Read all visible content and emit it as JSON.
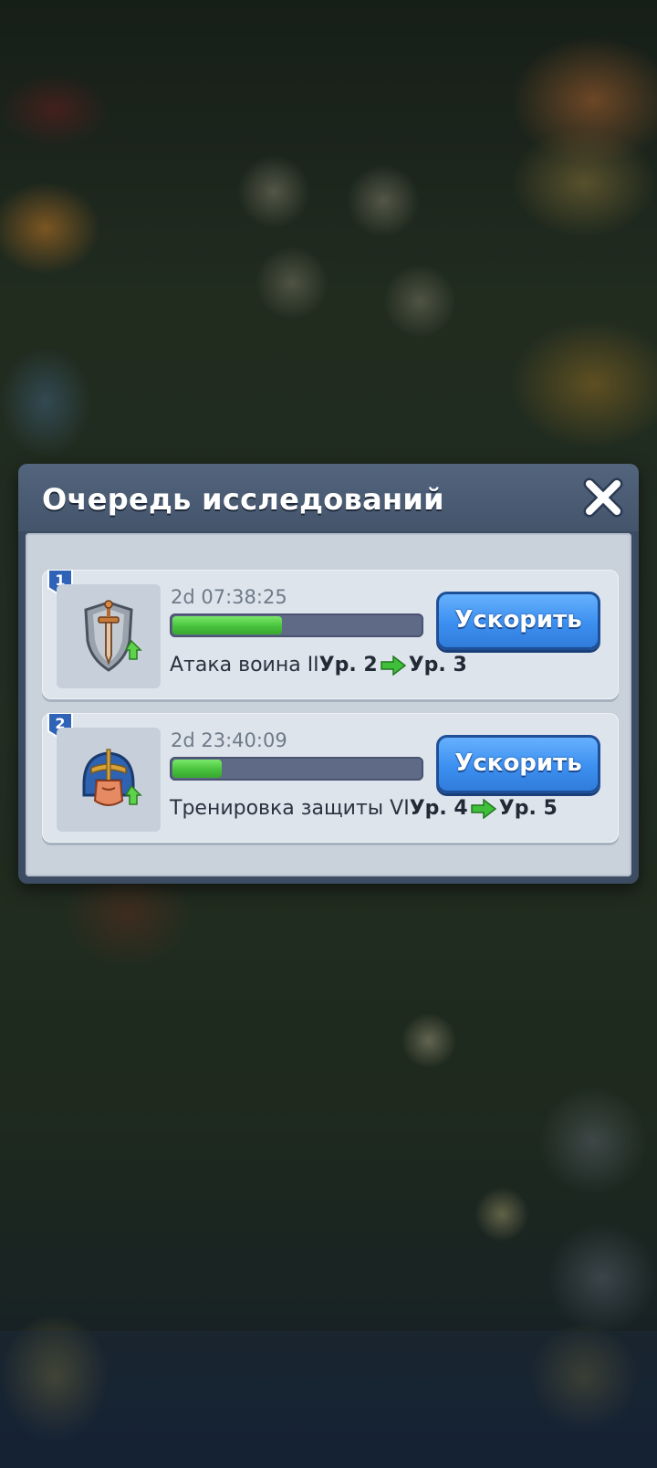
{
  "dialog": {
    "title": "Очередь исследований",
    "close_icon": "close-x-icon"
  },
  "queue": [
    {
      "position": "1",
      "icon": "sword-shield-upgrade-icon",
      "timer": "2d 07:38:25",
      "progress_percent": 44,
      "name": "Атака воина II",
      "level_from": "Ур. 2",
      "level_to": "Ур. 3",
      "button_label": "Ускорить"
    },
    {
      "position": "2",
      "icon": "helmet-upgrade-icon",
      "timer": "2d 23:40:09",
      "progress_percent": 20,
      "name": "Тренировка защиты VI",
      "level_from": "Ур. 4",
      "level_to": "Ур. 5",
      "button_label": "Ускорить"
    }
  ],
  "colors": {
    "progress_green": "#48c23d",
    "button_blue": "#3c8ff0",
    "arrow_green": "#3fbf3a"
  }
}
